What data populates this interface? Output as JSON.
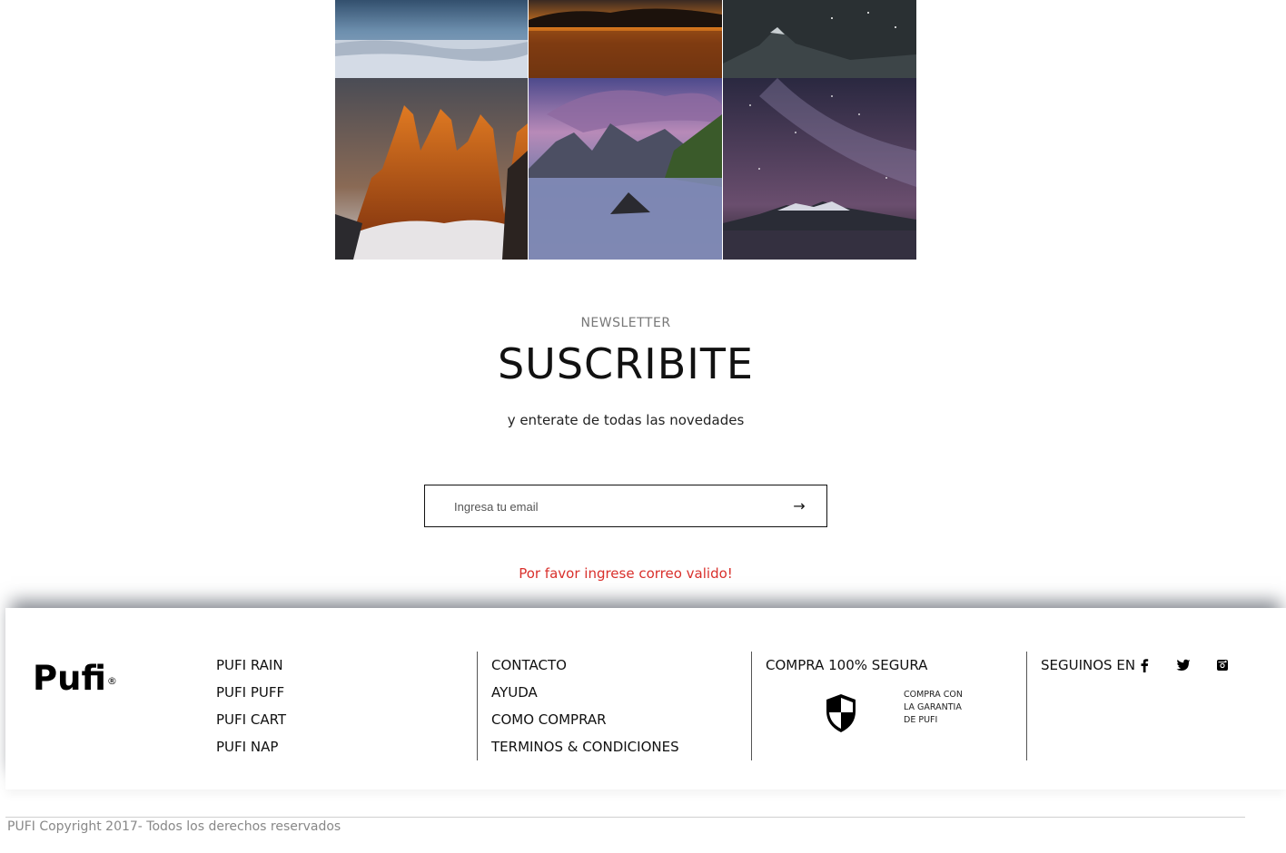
{
  "gallery": {
    "items": [
      "glacier-icefield",
      "sunset-lake",
      "night-volcano",
      "torres-peaks-sunrise",
      "cuernos-lake-clouds",
      "milky-way-mountain-lake"
    ]
  },
  "newsletter": {
    "kicker": "NEWSLETTER",
    "title": "SUSCRIBITE",
    "subtitle": "y enterate de todas las novedades",
    "email_placeholder": "Ingresa tu email",
    "submit_icon": "arrow-right-icon",
    "submit_glyph": "→",
    "error": "Por favor ingrese correo valido!",
    "error_color": "#d9302c"
  },
  "footer": {
    "logo": "Pufi",
    "logo_mark": "®",
    "products": [
      "PUFI RAIN",
      "PUFI PUFF",
      "PUFI CART",
      "PUFI NAP"
    ],
    "help_links": [
      "CONTACTO",
      "AYUDA",
      "COMO COMPRAR",
      "TERMINOS & CONDICIONES"
    ],
    "secure_title": "COMPRA 100% SEGURA",
    "secure_icon": "shield-icon",
    "guarantee_lines": [
      "COMPRA CON",
      "LA GARANTIA",
      "DE PUFI"
    ],
    "social_title": "SEGUINOS EN",
    "social": [
      "facebook-icon",
      "twitter-icon",
      "instagram-icon"
    ]
  },
  "copyright": "PUFI Copyright 2017- Todos los derechos reservados"
}
